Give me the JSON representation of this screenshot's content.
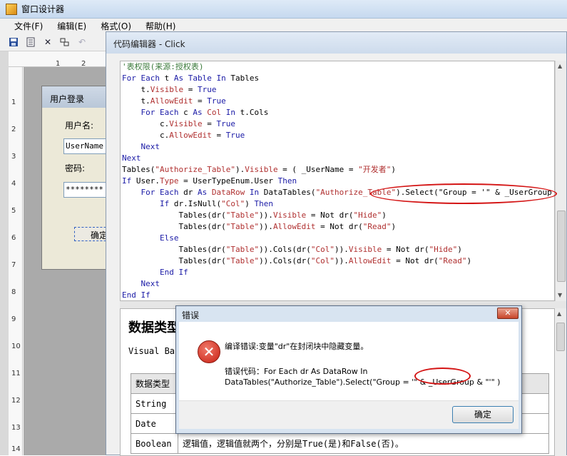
{
  "designer": {
    "title": "窗口设计器",
    "menu": [
      "文件(F)",
      "编辑(E)",
      "格式(O)",
      "帮助(H)"
    ],
    "ruler_top": [
      "1",
      "2"
    ],
    "ruler_left": [
      "1",
      "2",
      "3",
      "4",
      "5",
      "6",
      "7",
      "8",
      "9",
      "10",
      "11",
      "12",
      "13",
      "14"
    ]
  },
  "form": {
    "caption": "用户登录",
    "username_label": "用户名:",
    "username_value": "UserName",
    "password_label": "密码:",
    "password_value": "********",
    "ok_button": "确定"
  },
  "editor": {
    "title": "代码编辑器 - Click",
    "code_lines": [
      [
        {
          "t": "'表权限(来源:授权表)",
          "c": "cmt"
        }
      ],
      [
        {
          "t": "For Each ",
          "c": "kw"
        },
        {
          "t": "t ",
          "c": ""
        },
        {
          "t": "As ",
          "c": "kw"
        },
        {
          "t": "Table ",
          "c": "kw"
        },
        {
          "t": "In ",
          "c": "kw"
        },
        {
          "t": "Tables",
          "c": ""
        }
      ],
      [
        {
          "t": "    t.",
          "c": ""
        },
        {
          "t": "Visible",
          "c": "prop"
        },
        {
          "t": " = ",
          "c": ""
        },
        {
          "t": "True",
          "c": "kw"
        }
      ],
      [
        {
          "t": "    t.",
          "c": ""
        },
        {
          "t": "AllowEdit",
          "c": "prop"
        },
        {
          "t": " = ",
          "c": ""
        },
        {
          "t": "True",
          "c": "kw"
        }
      ],
      [
        {
          "t": "    For Each ",
          "c": "kw"
        },
        {
          "t": "c ",
          "c": ""
        },
        {
          "t": "As ",
          "c": "kw"
        },
        {
          "t": "Col ",
          "c": "prop"
        },
        {
          "t": "In ",
          "c": "kw"
        },
        {
          "t": "t.Cols",
          "c": ""
        }
      ],
      [
        {
          "t": "        c.",
          "c": ""
        },
        {
          "t": "Visible",
          "c": "prop"
        },
        {
          "t": " = ",
          "c": ""
        },
        {
          "t": "True",
          "c": "kw"
        }
      ],
      [
        {
          "t": "        c.",
          "c": ""
        },
        {
          "t": "AllowEdit",
          "c": "prop"
        },
        {
          "t": " = ",
          "c": ""
        },
        {
          "t": "True",
          "c": "kw"
        }
      ],
      [
        {
          "t": "    Next",
          "c": "kw"
        }
      ],
      [
        {
          "t": "Next",
          "c": "kw"
        }
      ],
      [
        {
          "t": "Tables(",
          "c": ""
        },
        {
          "t": "\"Authorize_Table\"",
          "c": "str"
        },
        {
          "t": ").",
          "c": ""
        },
        {
          "t": "Visible",
          "c": "prop"
        },
        {
          "t": " = ( _UserName = ",
          "c": ""
        },
        {
          "t": "\"开发者\"",
          "c": "str"
        },
        {
          "t": ")",
          "c": ""
        }
      ],
      [
        {
          "t": "If ",
          "c": "kw"
        },
        {
          "t": "User.",
          "c": ""
        },
        {
          "t": "Type",
          "c": "prop"
        },
        {
          "t": " = UserTypeEnum.User ",
          "c": ""
        },
        {
          "t": "Then",
          "c": "kw"
        }
      ],
      [
        {
          "t": "    For Each ",
          "c": "kw"
        },
        {
          "t": "dr ",
          "c": ""
        },
        {
          "t": "As ",
          "c": "kw"
        },
        {
          "t": "DataRow ",
          "c": "prop"
        },
        {
          "t": "In ",
          "c": "kw"
        },
        {
          "t": "DataTables(",
          "c": ""
        },
        {
          "t": "\"Authorize_Table\"",
          "c": "str"
        },
        {
          "t": ").Select(\"Group = '\" & _UserGroup  & \"'\")",
          "c": ""
        }
      ],
      [
        {
          "t": "        If ",
          "c": "kw"
        },
        {
          "t": "dr.IsNull(",
          "c": ""
        },
        {
          "t": "\"Col\"",
          "c": "str"
        },
        {
          "t": ") ",
          "c": ""
        },
        {
          "t": "Then",
          "c": "kw"
        }
      ],
      [
        {
          "t": "            Tables(dr(",
          "c": ""
        },
        {
          "t": "\"Table\"",
          "c": "str"
        },
        {
          "t": ")).",
          "c": ""
        },
        {
          "t": "Visible",
          "c": "prop"
        },
        {
          "t": " = Not dr(",
          "c": ""
        },
        {
          "t": "\"Hide\"",
          "c": "str"
        },
        {
          "t": ")",
          "c": ""
        }
      ],
      [
        {
          "t": "            Tables(dr(",
          "c": ""
        },
        {
          "t": "\"Table\"",
          "c": "str"
        },
        {
          "t": ")).",
          "c": ""
        },
        {
          "t": "AllowEdit",
          "c": "prop"
        },
        {
          "t": " = Not dr(",
          "c": ""
        },
        {
          "t": "\"Read\"",
          "c": "str"
        },
        {
          "t": ")",
          "c": ""
        }
      ],
      [
        {
          "t": "        Else",
          "c": "kw"
        }
      ],
      [
        {
          "t": "            Tables(dr(",
          "c": ""
        },
        {
          "t": "\"Table\"",
          "c": "str"
        },
        {
          "t": ")).Cols(dr(",
          "c": ""
        },
        {
          "t": "\"Col\"",
          "c": "str"
        },
        {
          "t": ")).",
          "c": ""
        },
        {
          "t": "Visible",
          "c": "prop"
        },
        {
          "t": " = Not dr(",
          "c": ""
        },
        {
          "t": "\"Hide\"",
          "c": "str"
        },
        {
          "t": ")",
          "c": ""
        }
      ],
      [
        {
          "t": "            Tables(dr(",
          "c": ""
        },
        {
          "t": "\"Table\"",
          "c": "str"
        },
        {
          "t": ")).Cols(dr(",
          "c": ""
        },
        {
          "t": "\"Col\"",
          "c": "str"
        },
        {
          "t": ")).",
          "c": ""
        },
        {
          "t": "AllowEdit",
          "c": "prop"
        },
        {
          "t": " = Not dr(",
          "c": ""
        },
        {
          "t": "\"Read\"",
          "c": "str"
        },
        {
          "t": ")",
          "c": ""
        }
      ],
      [
        {
          "t": "        End If",
          "c": "kw"
        }
      ],
      [
        {
          "t": "    Next",
          "c": "kw"
        }
      ],
      [
        {
          "t": "End If",
          "c": "kw"
        }
      ]
    ]
  },
  "help": {
    "title": "数据类型",
    "subtitle": "Visual Bas",
    "table_header": [
      "数据类型",
      ""
    ],
    "rows": [
      [
        "String",
        ""
      ],
      [
        "Date",
        ""
      ],
      [
        "Boolean",
        "逻辑值，逻辑值就两个，分别是True(是)和False(否)。"
      ]
    ]
  },
  "dialog": {
    "title": "错误",
    "close_label": "✕",
    "message": "编译错误:变量\"dr\"在封闭块中隐藏变量。",
    "code_line1": "错误代码：For Each dr As DataRow In",
    "code_line2": "DataTables(\"Authorize_Table\").Select(\"Group = '\" & _UserGroup & \"'\" )",
    "ok_label": "确定"
  },
  "colors": {
    "keyword": "#1a1aa6",
    "property": "#b03030",
    "comment": "#3a7a3a",
    "annotation": "#d41414"
  },
  "icons": [
    "save-icon",
    "save-all-icon",
    "delete-icon",
    "layout-icon",
    "undo-icon",
    "error-icon",
    "close-icon"
  ]
}
